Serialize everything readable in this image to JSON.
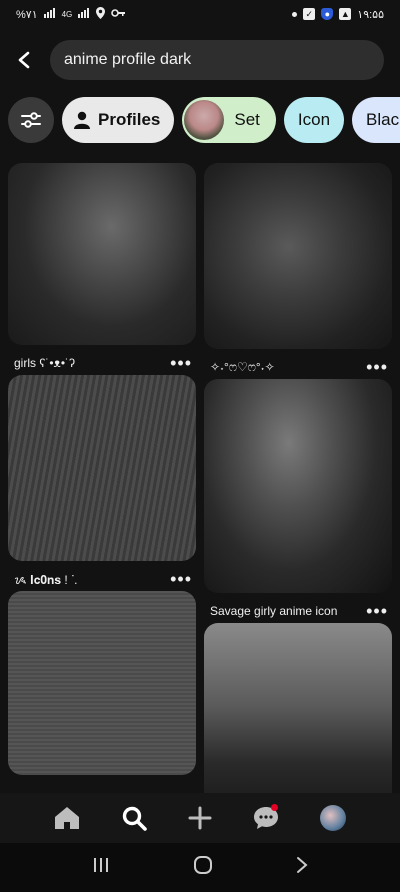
{
  "status": {
    "left_text": "%۷۱",
    "net": "4G",
    "time": "۱۹:۵۵"
  },
  "search": {
    "query": "anime profile dark"
  },
  "chips": {
    "profiles": "Profiles",
    "set": "Set",
    "icon": "Icon",
    "black": "Black"
  },
  "pins": [
    {
      "title": "girls ʕ˙•ᴥ•˙ʔ",
      "more": "•••"
    },
    {
      "title": "✧˖°ෆ♡ෆ°˖✧",
      "more": "•••"
    },
    {
      "title": "ᝰ 𝐈𝐜𝟎𝐧𝐬 ! ᐝ.",
      "more": "•••"
    },
    {
      "title": "Savage girly anime icon",
      "more": "•••"
    }
  ],
  "colors": {
    "background": "#121212",
    "search_bg": "#2e2e2e",
    "accent_red": "#e60023"
  },
  "icons": {
    "back": "back-arrow-icon",
    "filter": "filter-sliders-icon",
    "profile": "person-icon",
    "home": "home-icon",
    "search": "search-icon",
    "create": "plus-icon",
    "messages": "chat-icon"
  }
}
